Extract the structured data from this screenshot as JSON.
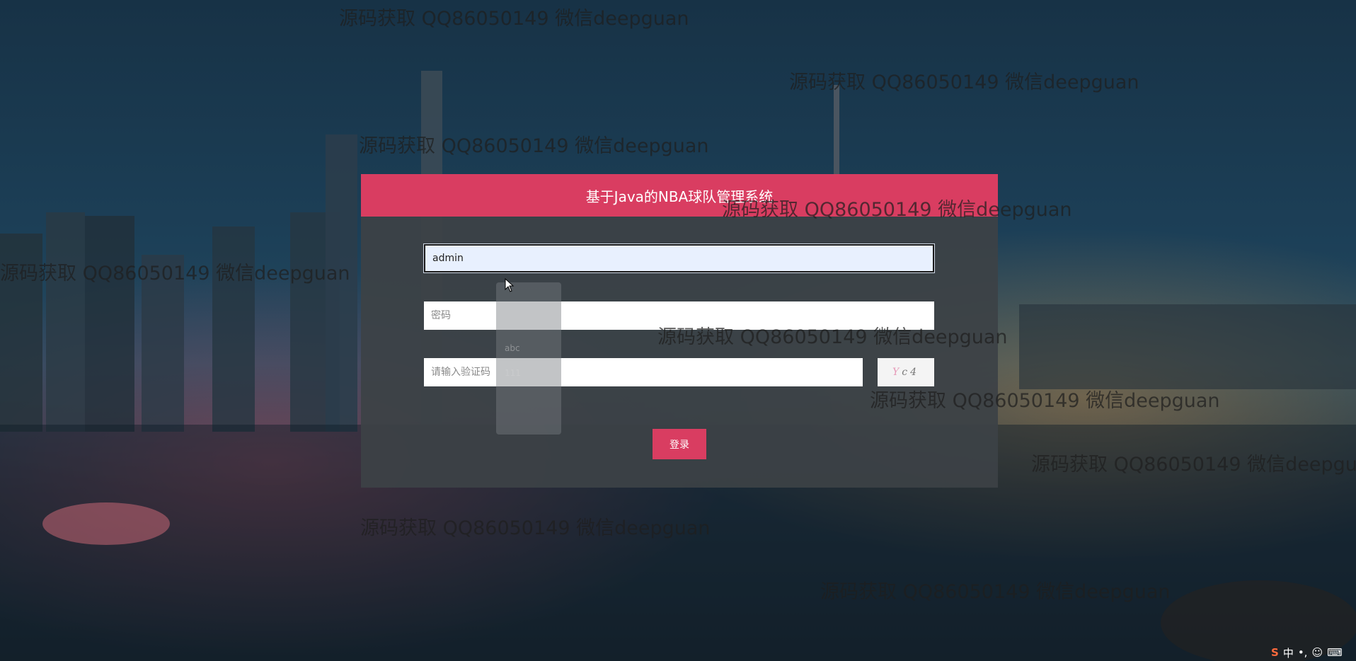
{
  "login": {
    "title": "基于Java的NBA球队管理系统",
    "username_value": "admin",
    "password_placeholder": "密码",
    "captcha_placeholder": "请输入验证码",
    "login_label": "登录"
  },
  "autocomplete": {
    "items": [
      "",
      "",
      "abc",
      "111",
      "",
      ""
    ]
  },
  "watermarks": [
    "源码获取 QQ86050149 微信deepguan",
    "源码获取 QQ86050149 微信deepguan",
    "源码获取 QQ86050149 微信deepguan",
    "源码获取 QQ86050149 微信deepguan",
    "源码获取 QQ86050149 微信deepguan",
    "源码获取 QQ86050149 微信deepguan",
    "源码获取 QQ86050149 微信deepguan",
    "源码获取 QQ86050149 微信deepguan",
    "源码获取 QQ86050149 微信deepguan",
    "源码获取 QQ86050149 微信deepguan"
  ],
  "tray": {
    "ime_logo": "S",
    "ime_mode": "中"
  }
}
